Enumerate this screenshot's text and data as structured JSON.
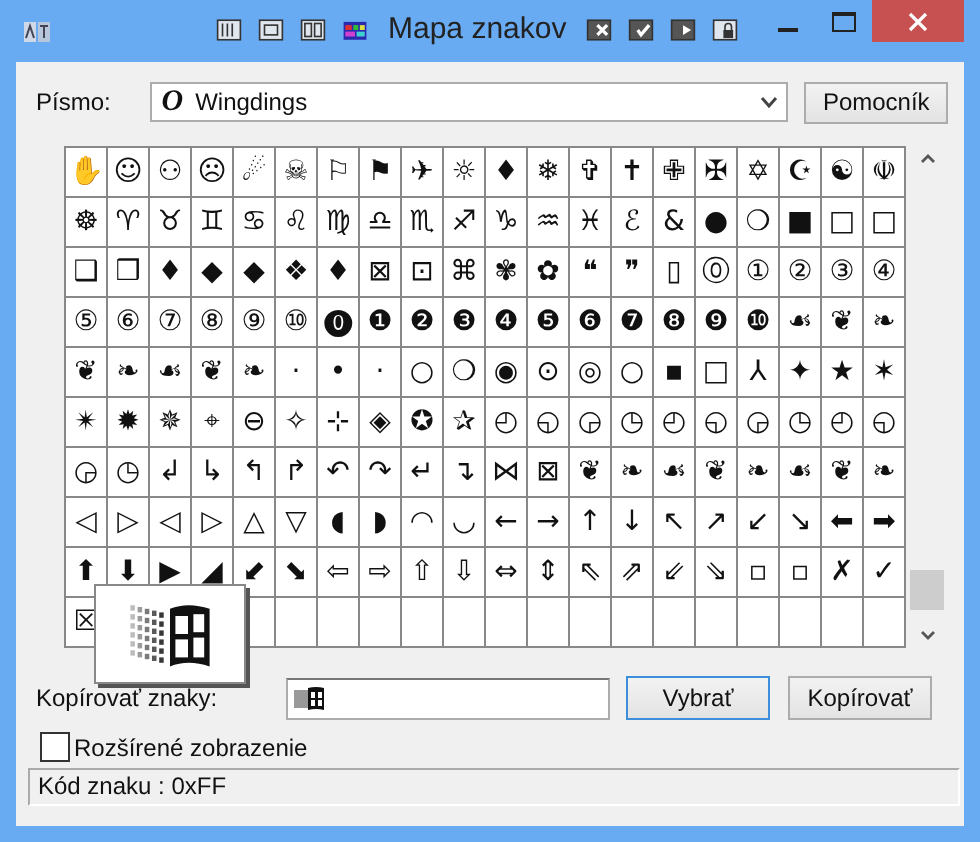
{
  "window": {
    "title": "Mapa znakov"
  },
  "font": {
    "label": "Písmo:",
    "type_mark": "O",
    "value": "Wingdings",
    "help_button": "Pomocník"
  },
  "grid": [
    [
      "✋",
      "☺",
      "⚇",
      "☹",
      "☄",
      "☠",
      "⚐",
      "⚑",
      "✈",
      "☼",
      "♦",
      "❄",
      "✞",
      "✝",
      "✙",
      "✠",
      "✡",
      "☪",
      "☯",
      "☫"
    ],
    [
      "☸",
      "♈",
      "♉",
      "♊",
      "♋",
      "♌",
      "♍",
      "♎",
      "♏",
      "♐",
      "♑",
      "♒",
      "♓",
      "ℰ",
      "&",
      "●",
      "❍",
      "■",
      "□",
      "□"
    ],
    [
      "❑",
      "❒",
      "♦",
      "◆",
      "◆",
      "❖",
      "♦",
      "⊠",
      "⊡",
      "⌘",
      "✾",
      "✿",
      "❝",
      "❞",
      "▯",
      "⓪",
      "①",
      "②",
      "③",
      "④"
    ],
    [
      "⑤",
      "⑥",
      "⑦",
      "⑧",
      "⑨",
      "⑩",
      "⓿",
      "❶",
      "❷",
      "❸",
      "❹",
      "❺",
      "❻",
      "❼",
      "❽",
      "❾",
      "❿",
      "☙",
      "❦",
      "❧"
    ],
    [
      "❦",
      "❧",
      "☙",
      "❦",
      "❧",
      "·",
      "•",
      "·",
      "○",
      "❍",
      "◉",
      "⊙",
      "◎",
      "○",
      "▪",
      "□",
      "⅄",
      "✦",
      "★",
      "✶"
    ],
    [
      "✴",
      "✹",
      "✵",
      "⌖",
      "⊖",
      "✧",
      "⊹",
      "◈",
      "✪",
      "✰",
      "◴",
      "◵",
      "◶",
      "◷",
      "◴",
      "◵",
      "◶",
      "◷",
      "◴",
      "◵"
    ],
    [
      "◶",
      "◷",
      "↲",
      "↳",
      "↰",
      "↱",
      "↶",
      "↷",
      "↵",
      "↴",
      "⋈",
      "⊠",
      "❦",
      "❧",
      "☙",
      "❦",
      "❧",
      "☙",
      "❦",
      "❧"
    ],
    [
      "◁",
      "▷",
      "◁",
      "▷",
      "△",
      "▽",
      "◖",
      "◗",
      "◠",
      "◡",
      "←",
      "→",
      "↑",
      "↓",
      "↖",
      "↗",
      "↙",
      "↘",
      "⬅",
      "➡"
    ],
    [
      "⬆",
      "⬇",
      "▶",
      "◢",
      "⬋",
      "⬊",
      "⇦",
      "⇨",
      "⇧",
      "⇩",
      "⇔",
      "⇕",
      "⇖",
      "⇗",
      "⇙",
      "⇘",
      "▫",
      "▫",
      "✗",
      "✓"
    ],
    [
      "☒"
    ]
  ],
  "copy": {
    "label": "Kopírovať znaky:",
    "select_button": "Vybrať",
    "copy_button": "Kopírovať"
  },
  "advanced": {
    "label": "Rozšírené zobrazenie",
    "checked": false
  },
  "status_bar": "Kód znaku : 0xFF"
}
